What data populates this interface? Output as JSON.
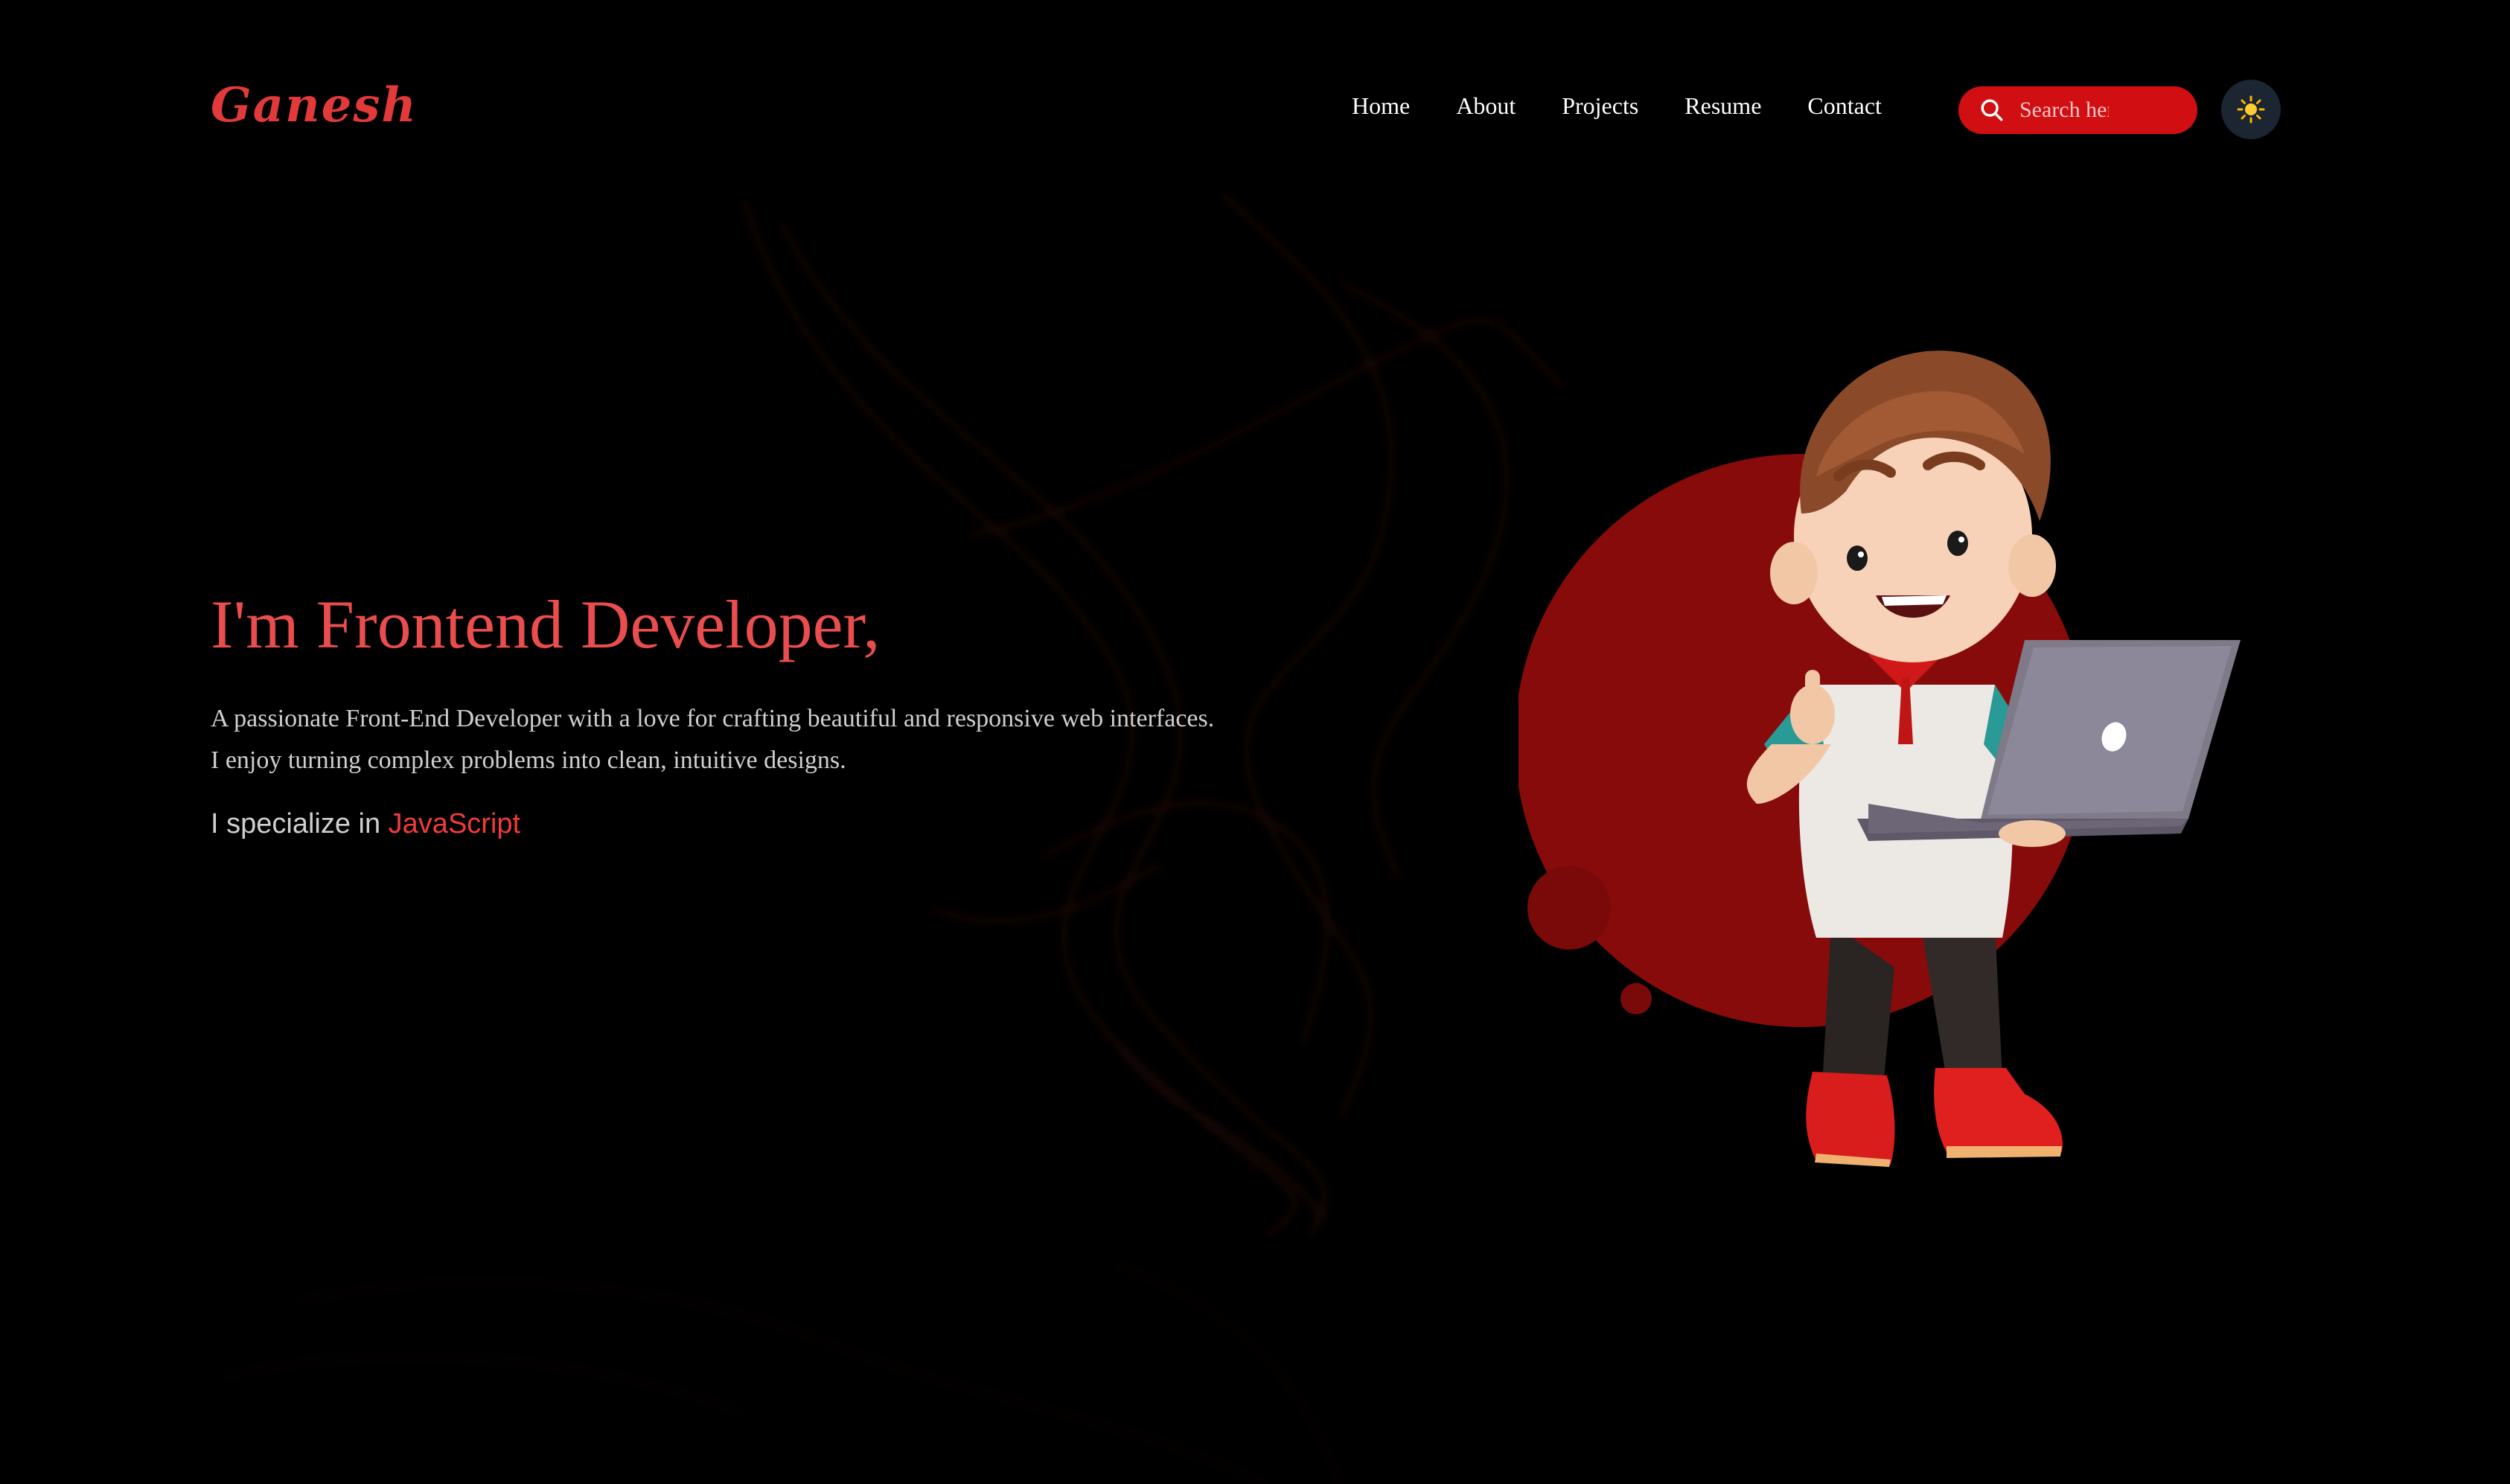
{
  "brand": {
    "logo": "Ganesh"
  },
  "nav": {
    "items": [
      {
        "label": "Home"
      },
      {
        "label": "About"
      },
      {
        "label": "Projects"
      },
      {
        "label": "Resume"
      },
      {
        "label": "Contact"
      }
    ]
  },
  "search": {
    "placeholder": "Search here..."
  },
  "theme_toggle": {
    "icon": "sun-icon"
  },
  "hero": {
    "title": "I'm Frontend Developer,",
    "description_line1": "A passionate Front-End Developer with a love for crafting beautiful and responsive web interfaces.",
    "description_line2": "I enjoy turning complex problems into clean, intuitive designs.",
    "specialize_prefix": "I specialize in ",
    "specialize_skill": "JavaScript"
  },
  "colors": {
    "accent": "#e94d4d",
    "search_bg": "#d10e12",
    "toggle_bg": "#1c2532",
    "circle": "#8b0e0e"
  }
}
